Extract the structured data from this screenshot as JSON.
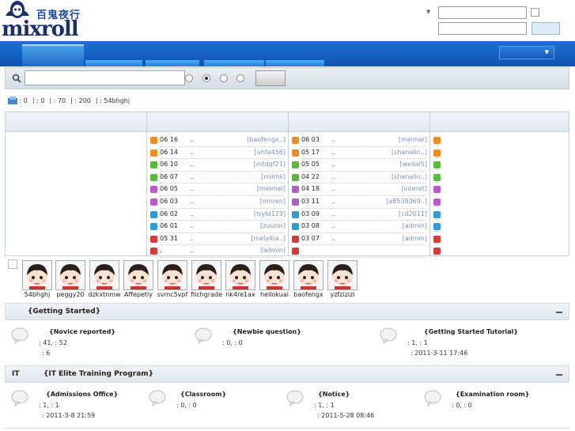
{
  "header": {
    "site_name_cn": "百鬼夜行",
    "site_name": "mixroll",
    "dropdown_arrow": "▼"
  },
  "nav": {
    "dropdown_arrow": "▼"
  },
  "stats": {
    "s1": ": 0",
    "s2": ": 0",
    "s3": ": 70",
    "s4": ": 200",
    "latest_member": ": 54bhghj"
  },
  "grid": {
    "col1": [
      {
        "date": "06 16",
        "dots": "..",
        "user": "[baofengx..]",
        "color": "#f08c1e"
      },
      {
        "date": "06 14",
        "dots": "..",
        "user": "[uhfa456]",
        "color": "#f08c1e"
      },
      {
        "date": "06 10",
        "dots": "..",
        "user": "[mtdqf21]",
        "color": "#5cb83c"
      },
      {
        "date": "06 07",
        "dots": "..",
        "user": "[miimii]",
        "color": "#5cb83c"
      },
      {
        "date": "06 05",
        "dots": "..",
        "user": "[meimei]",
        "color": "#b45cc8"
      },
      {
        "date": "06 03",
        "dots": "..",
        "user": "[mnren]",
        "color": "#b45cc8"
      },
      {
        "date": "06 02",
        "dots": "..",
        "user": "[tryld123]",
        "color": "#2e9bd6"
      },
      {
        "date": "06 01",
        "dots": "..",
        "user": "[zuuror]",
        "color": "#2e9bd6"
      },
      {
        "date": "05 31",
        "dots": "..",
        "user": "[meiyitia..]",
        "color": "#d83a3a"
      },
      {
        "date": ",",
        "dots": "..",
        "user": "[admin]",
        "color": "#d83a3a"
      }
    ],
    "col2": [
      {
        "date": "06 03",
        "dots": "..",
        "user": "[meimei]",
        "color": "#f08c1e"
      },
      {
        "date": "05 17",
        "dots": "..",
        "user": "[shanalin..]",
        "color": "#f08c1e"
      },
      {
        "date": "05 05",
        "dots": "..",
        "user": "[weilai5]",
        "color": "#5cb83c"
      },
      {
        "date": "04 22",
        "dots": "..",
        "user": "[shanalin..]",
        "color": "#5cb83c"
      },
      {
        "date": "04 18",
        "dots": "..",
        "user": "[interet]",
        "color": "#b45cc8"
      },
      {
        "date": "03 11",
        "dots": "..",
        "user": "[a8539369..]",
        "color": "#b45cc8"
      },
      {
        "date": "03 09",
        "dots": "..",
        "user": "[cd2011]",
        "color": "#2e9bd6"
      },
      {
        "date": "03 08",
        "dots": "..",
        "user": "[admin]",
        "color": "#2e9bd6"
      },
      {
        "date": "03 07",
        "dots": "..",
        "user": "[admin]",
        "color": "#d83a3a"
      },
      {
        "date": "",
        "dots": "",
        "user": "",
        "color": "#d83a3a"
      }
    ],
    "col3": [
      {
        "text": "..",
        "color": "#f08c1e"
      },
      {
        "text": "..",
        "color": "#f08c1e"
      },
      {
        "text": "..",
        "color": "#5cb83c"
      },
      {
        "text": "..",
        "color": "#5cb83c"
      },
      {
        "text": "..",
        "color": "#b45cc8"
      },
      {
        "text": "..",
        "color": "#b45cc8"
      },
      {
        "text": "..",
        "color": "#2e9bd6"
      },
      {
        "text": "..",
        "color": "#2e9bd6"
      },
      {
        "text": "..",
        "color": "#d83a3a"
      },
      {
        "text": "..",
        "color": "#d83a3a"
      }
    ]
  },
  "members": [
    "54bhghj",
    "peggy20",
    "dzkxtnmw",
    "Affepetly",
    "svmc5vpf",
    "filchgrade",
    "nk4re1ax",
    "hellokuai",
    "baofengx",
    "yzfzizizi"
  ],
  "sections": [
    {
      "title": "{Getting Started}",
      "prefix": "",
      "forums": [
        {
          "name": "{Novice reported}",
          "stat": ": 41,   : 52",
          "last": ": 6"
        },
        {
          "name": "{Newbie question}",
          "stat": ": 0,   : 0",
          "last": ""
        },
        {
          "name": "{Getting Started Tutorial}",
          "stat": ": 1,   : 1",
          "last": ": 2011-3-11 17:46"
        }
      ]
    },
    {
      "title": "{IT Elite Training Program}",
      "prefix": "IT",
      "forums": [
        {
          "name": "{Admissions Office}",
          "stat": ": 1,   : 1",
          "last": ": 2011-3-8 21:59"
        },
        {
          "name": "{Classroom}",
          "stat": ": 0,   : 0",
          "last": ""
        },
        {
          "name": "{Notice}",
          "stat": ": 1,   : 1",
          "last": ": 2011-5-28 08:46"
        },
        {
          "name": "{Examination room}",
          "stat": ": 0,   : 0",
          "last": ""
        }
      ]
    }
  ]
}
